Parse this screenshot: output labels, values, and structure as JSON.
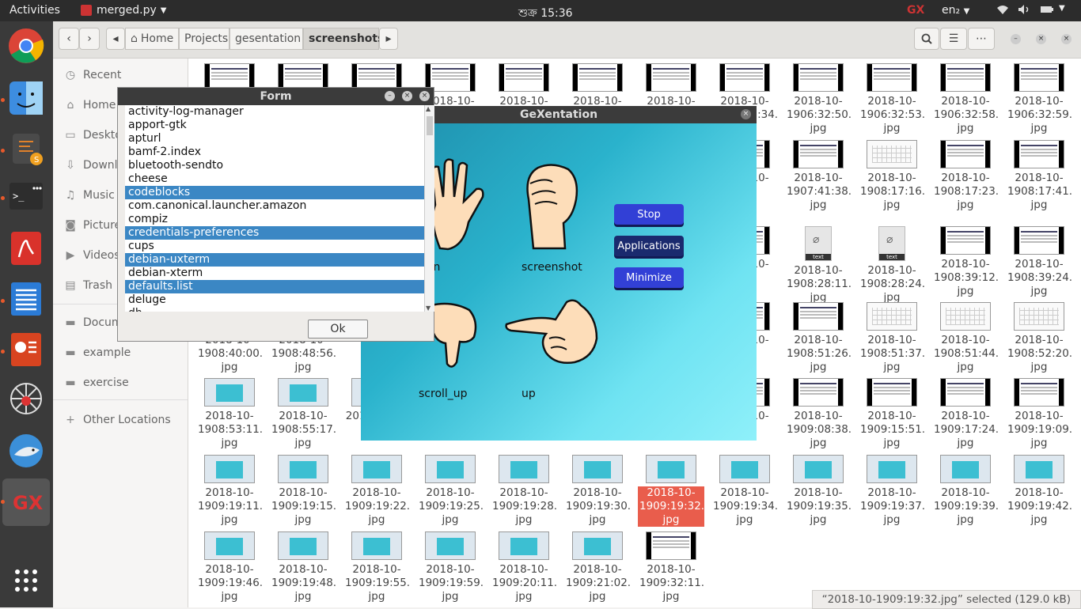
{
  "topbar": {
    "activities": "Activities",
    "app_name": "merged.py",
    "clock": "শুক্র 15:36",
    "lang": "en₂"
  },
  "dock": {
    "items": [
      "chrome-icon",
      "finder-icon",
      "sublime-text-icon",
      "terminal-icon",
      "pdf-reader-icon",
      "writer-icon",
      "impress-icon",
      "spider-icon",
      "shark-icon",
      "gexentation-icon",
      "app-grid-icon"
    ]
  },
  "header": {
    "crumbs": [
      "Home",
      "Projects",
      "gesentation",
      "screenshots"
    ]
  },
  "sidebar": {
    "items": [
      "Recent",
      "Home",
      "Desktop",
      "Downloads",
      "Music",
      "Pictures",
      "Videos",
      "Trash",
      "Documents",
      "example",
      "exercise",
      "Other Locations"
    ]
  },
  "files": {
    "rows": [
      [
        "2018-10-",
        "2018-10-",
        "2018-10-",
        "2018-10-",
        "2018-10-",
        "2018-10-",
        "2018-10-",
        "2018-10-1906:32:34.jpg",
        "2018-10-1906:32:50.jpg",
        "2018-10-1906:32:53.jpg",
        "2018-10-1906:32:58.jpg",
        "2018-10-1906:32:59.jpg"
      ],
      [
        "",
        "",
        "",
        "",
        "",
        "",
        "",
        "2018-10-03.",
        "2018-10-1907:41:38.jpg",
        "2018-10-1908:17:16.jpg",
        "2018-10-1908:17:23.jpg",
        "2018-10-1908:17:41.jpg"
      ],
      [
        "",
        "",
        "",
        "",
        "",
        "",
        "",
        "2018-10-03.",
        "2018-10-1908:28:11.jpg",
        "2018-10-1908:28:24.jpg",
        "2018-10-1908:39:12.jpg",
        "2018-10-1908:39:24.jpg"
      ],
      [
        "2018-10-1908:40:00.jpg",
        "2018-10-1908:48:56.jpg",
        "",
        "",
        "",
        "",
        "",
        "2018-10-24.",
        "2018-10-1908:51:26.jpg",
        "2018-10-1908:51:37.jpg",
        "2018-10-1908:51:44.jpg",
        "2018-10-1908:52:20.jpg"
      ],
      [
        "2018-10-1908:53:11.jpg",
        "2018-10-1908:55:17.jpg",
        "2018-10-19",
        "",
        "",
        "",
        "",
        "2018-10-24.",
        "2018-10-1909:08:38.jpg",
        "2018-10-1909:15:51.jpg",
        "2018-10-1909:17:24.jpg",
        "2018-10-1909:19:09.jpg"
      ],
      [
        "2018-10-1909:19:11.jpg",
        "2018-10-1909:19:15.jpg",
        "2018-10-1909:19:22.jpg",
        "2018-10-1909:19:25.jpg",
        "2018-10-1909:19:28.jpg",
        "2018-10-1909:19:30.jpg",
        "2018-10-1909:19:32.jpg",
        "2018-10-1909:19:34.jpg",
        "2018-10-1909:19:35.jpg",
        "2018-10-1909:19:37.jpg",
        "2018-10-1909:19:39.jpg",
        "2018-10-1909:19:42.jpg"
      ],
      [
        "2018-10-1909:19:46.jpg",
        "2018-10-1909:19:48.jpg",
        "2018-10-1909:19:55.jpg",
        "2018-10-1909:19:59.jpg",
        "2018-10-1909:20:11.jpg",
        "2018-10-1909:21:02.jpg",
        "2018-10-1909:32:11.jpg"
      ]
    ],
    "text_file_label": "text"
  },
  "status": "“2018-10-1909:19:32.jpg” selected  (129.0 kB)",
  "gexentation": {
    "title": "GeXentation",
    "labels": [
      "wn",
      "screenshot",
      "scroll_up",
      "up"
    ],
    "buttons": [
      "Stop",
      "Applications",
      "Minimize"
    ]
  },
  "form": {
    "title": "Form",
    "items": [
      "activity-log-manager",
      "apport-gtk",
      "apturl",
      "bamf-2.index",
      "bluetooth-sendto",
      "cheese",
      "codeblocks",
      "com.canonical.launcher.amazon",
      "compiz",
      "credentials-preferences",
      "cups",
      "debian-uxterm",
      "debian-xterm",
      "defaults.list",
      "deluge",
      "dh"
    ],
    "selected": [
      6,
      9,
      11,
      13
    ],
    "ok": "Ok"
  }
}
